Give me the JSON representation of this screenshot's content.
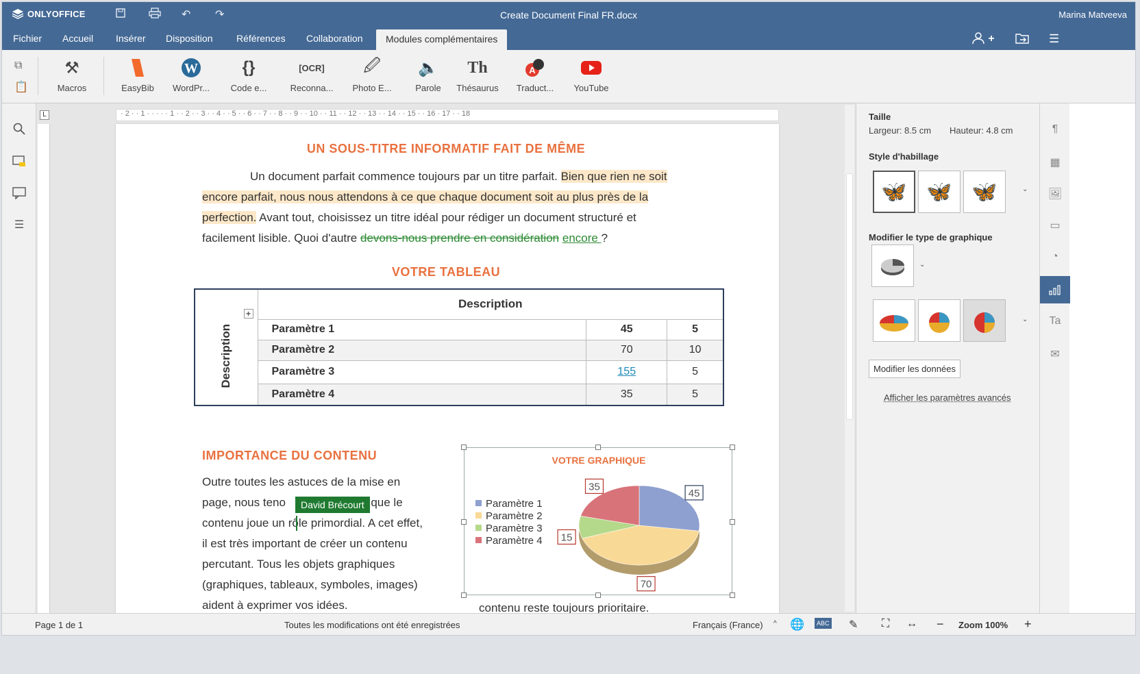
{
  "app": {
    "logo": "ONLYOFFICE",
    "doc_title": "Create Document Final FR.docx",
    "user": "Marina Matveeva"
  },
  "menu": {
    "tabs": [
      "Fichier",
      "Accueil",
      "Insérer",
      "Disposition",
      "Références",
      "Collaboration",
      "Modules complémentaires"
    ]
  },
  "toolbar": {
    "buttons": [
      "Macros",
      "EasyBib",
      "WordPr...",
      "Code e...",
      "Reconna...",
      "Photo E...",
      "Parole",
      "Thésaurus",
      "Traduct...",
      "YouTube"
    ]
  },
  "ruler": {
    "marks": "· 2 · · 1 · · ·   · · 1 · · 2 · · 3 · · 4 · · 5 · · 6 · · 7 · · 8 · · 9 · · 10 · · 11 · · 12 · · 13 · · 14 · · 15 · · 16 ·   17 · · 18"
  },
  "doc": {
    "h1": "UN SOUS-TITRE INFORMATIF FAIT DE MÊME",
    "p1_a": "Un document parfait commence toujours par un titre parfait. ",
    "p1_hl1": "Bien que rien ne soit",
    "p1_hl2": "encore parfait, nous nous attendons à ce que chaque document soit au plus près de la",
    "p1_hl3": "perfection.",
    "p1_b": " Avant tout, choisissez un titre idéal pour rédiger un document structuré et",
    "p1_c": "facilement lisible. Quoi d'autre ",
    "p1_del": "devons-nous prendre en considération",
    "p1_ins": "encore ",
    "p1_q": "?",
    "h2": "VOTRE TABLEAU",
    "table": {
      "header": "Description",
      "side": "Description",
      "rows": [
        [
          "Paramètre 1",
          "45",
          "5"
        ],
        [
          "Paramètre 2",
          "70",
          "10"
        ],
        [
          "Paramètre 3",
          "155",
          "5"
        ],
        [
          "Paramètre 4",
          "35",
          "5"
        ]
      ]
    },
    "h3": "IMPORTANCE DU CONTENU",
    "p2_l1": "Outre toutes les astuces de la mise en",
    "p2_l2a": "page, nous teno",
    "p2_l2b": "r que le",
    "p2_l3": "contenu joue un rôle primordial. A cet effet,",
    "p2_l4": "il est très important de créer un contenu",
    "p2_l5": "percutant. Tous les objets graphiques",
    "p2_l6": "(graphiques, tableaux, symboles,  images)",
    "p2_l7": "aident à exprimer vos idées.",
    "p3": "contenu reste toujours prioritaire.",
    "tooltip": "David Brécourt"
  },
  "chart_data": {
    "type": "pie",
    "title": "VOTRE GRAPHIQUE",
    "categories": [
      "Paramètre 1",
      "Paramètre 2",
      "Paramètre 3",
      "Paramètre 4"
    ],
    "values": [
      45,
      70,
      15,
      35
    ],
    "colors": [
      "#8ea0cf",
      "#f9d996",
      "#b5d98a",
      "#d9737a"
    ],
    "legend": "left",
    "data_labels": true
  },
  "panel": {
    "size_label": "Taille",
    "width": "Largeur: 8.5 cm",
    "height": "Hauteur: 4.8 cm",
    "wrap_label": "Style d'habillage",
    "chart_type_label": "Modifier le type de graphique",
    "edit_data": "Modifier les données",
    "advanced": "Afficher les paramètres avancés"
  },
  "status": {
    "page": "Page 1 de 1",
    "saved": "Toutes les modifications ont été enregistrées",
    "lang": "Français (France)",
    "zoom": "Zoom 100%"
  }
}
